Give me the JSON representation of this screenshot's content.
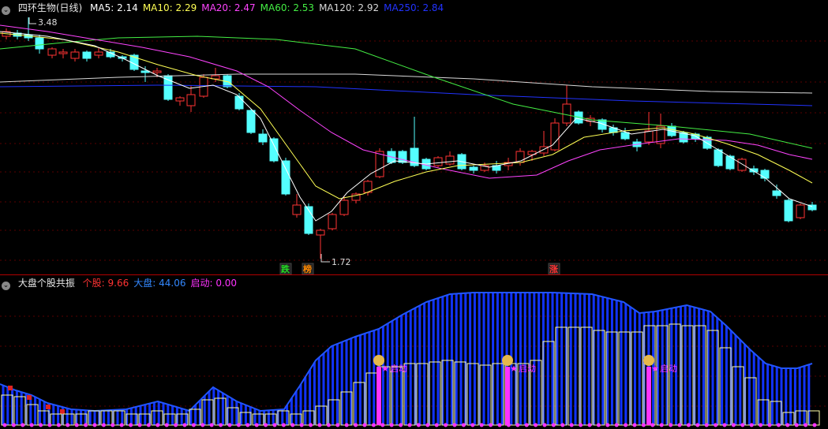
{
  "main": {
    "title": "四环生物(日线)",
    "ma": [
      {
        "name": "MA5",
        "value": "2.14",
        "color": "#ffffff"
      },
      {
        "name": "MA10",
        "value": "2.29",
        "color": "#ffff55"
      },
      {
        "name": "MA20",
        "value": "2.47",
        "color": "#ff44ff"
      },
      {
        "name": "MA60",
        "value": "2.53",
        "color": "#44ee44"
      },
      {
        "name": "MA120",
        "value": "2.92",
        "color": "#d8d8d8"
      },
      {
        "name": "MA250",
        "value": "2.84",
        "color": "#2233ff"
      }
    ],
    "high_label": "3.48",
    "low_label": "1.72",
    "signals": [
      {
        "text": "跌",
        "color": "#22dd22"
      },
      {
        "text": "榜",
        "color": "#ff8800"
      },
      {
        "text": "涨",
        "color": "#ff3333"
      }
    ]
  },
  "sub": {
    "title": "大盘个股共振",
    "items": [
      {
        "name": "个股",
        "value": "9.66",
        "color": "#ff3333"
      },
      {
        "name": "大盘",
        "value": "44.06",
        "color": "#3388ff"
      },
      {
        "name": "启动",
        "value": "0.00",
        "color": "#ff33ff"
      }
    ],
    "marker_label": "启动"
  },
  "colors": {
    "up": "#ff3333",
    "down": "#54ffff",
    "bg": "#000000",
    "grid": "#5a0000",
    "bar": "#ffffaa",
    "blue": "#1133ff"
  }
}
